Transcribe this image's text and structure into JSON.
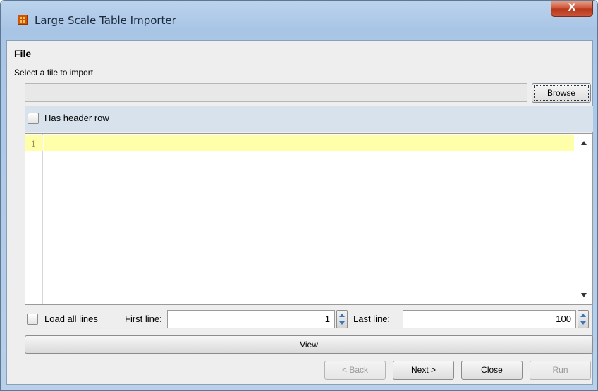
{
  "window": {
    "title": "Large Scale Table Importer",
    "close_label": "X"
  },
  "file_section": {
    "title": "File",
    "select_label": "Select a file to import",
    "file_path": "",
    "browse_label": "Browse",
    "has_header_label": "Has header row",
    "has_header_checked": false
  },
  "preview": {
    "line_numbers": [
      "1"
    ],
    "content": ""
  },
  "range": {
    "load_all_label": "Load all lines",
    "load_all_checked": false,
    "first_line_label": "First line:",
    "first_line_value": "1",
    "last_line_label": "Last line:",
    "last_line_value": "100"
  },
  "buttons": {
    "view_label": "View",
    "back_label": "< Back",
    "next_label": "Next >",
    "close_label": "Close",
    "run_label": "Run"
  },
  "colors": {
    "current_line_highlight": "#ffffaa",
    "header_row_bg": "#d8e2ec",
    "titlebar": "#a9c5e6"
  }
}
